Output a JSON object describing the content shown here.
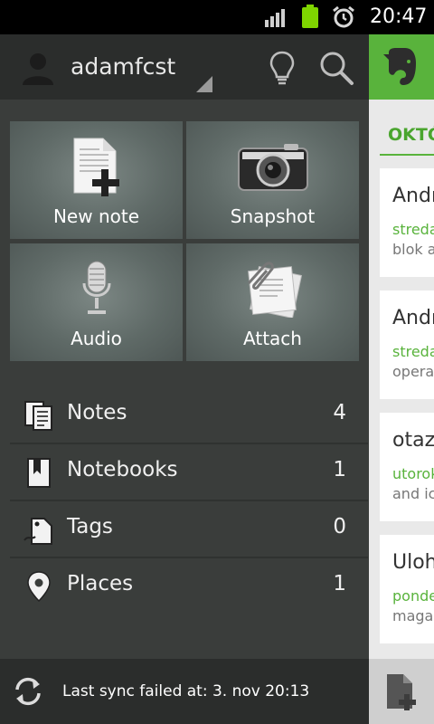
{
  "status_bar": {
    "time": "20:47",
    "colors": {
      "battery": "#7fd500"
    }
  },
  "drawer": {
    "account": {
      "username": "adamfcst"
    },
    "quick_actions": [
      {
        "label": "New note",
        "icon": "new-note-icon"
      },
      {
        "label": "Snapshot",
        "icon": "camera-icon"
      },
      {
        "label": "Audio",
        "icon": "microphone-icon"
      },
      {
        "label": "Attach",
        "icon": "paperclip-icon"
      }
    ],
    "nav": [
      {
        "label": "Notes",
        "count": "4",
        "icon": "notes-icon"
      },
      {
        "label": "Notebooks",
        "count": "1",
        "icon": "notebook-icon"
      },
      {
        "label": "Tags",
        "count": "0",
        "icon": "tag-icon"
      },
      {
        "label": "Places",
        "count": "1",
        "icon": "place-pin-icon"
      }
    ],
    "sync": {
      "text": "Last sync failed at: 3. nov 20:13"
    }
  },
  "notes_pane": {
    "date_header": "OKTÓ",
    "notes": [
      {
        "title": "Andr",
        "date": "streda",
        "snippet": "blok a"
      },
      {
        "title": "Andr",
        "date": "streda",
        "snippet": "opera"
      },
      {
        "title": "otaz",
        "date": "utorok",
        "snippet": "and ic"
      },
      {
        "title": "Uloh",
        "date": "ponde",
        "snippet": "magaz"
      }
    ],
    "colors": {
      "accent": "#59b33c"
    }
  }
}
